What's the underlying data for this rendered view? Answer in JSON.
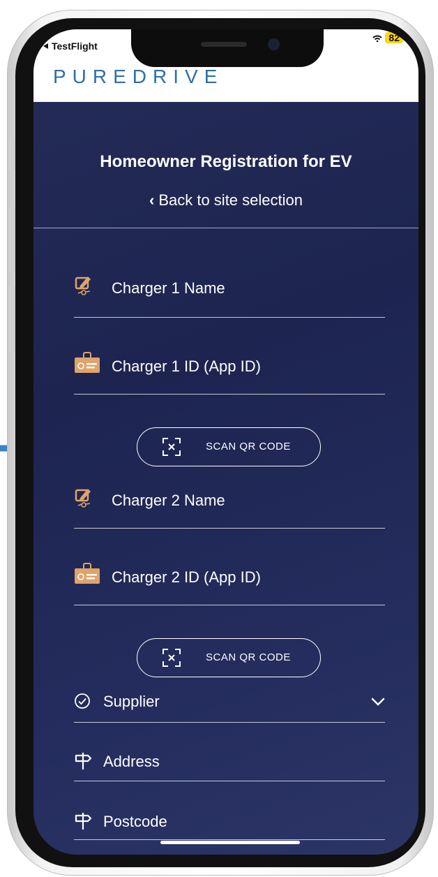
{
  "status_bar": {
    "back_app": "TestFlight",
    "battery": "82"
  },
  "header": {
    "logo": "PUREDRIVE"
  },
  "page": {
    "title": "Homeowner Registration for EV",
    "back_link": "Back to site selection"
  },
  "form": {
    "charger1_name": "Charger 1 Name",
    "charger1_id": "Charger 1 ID (App ID)",
    "scan_qr_1": "SCAN QR CODE",
    "charger2_name": "Charger 2 Name",
    "charger2_id": "Charger 2 ID (App ID)",
    "scan_qr_2": "SCAN QR CODE",
    "supplier": "Supplier",
    "address": "Address",
    "postcode": "Postcode"
  },
  "colors": {
    "background": "#1f2653",
    "accent_orange": "#e0a36a",
    "logo_blue": "#2f6ea8",
    "arrow_blue": "#3b83c6"
  }
}
